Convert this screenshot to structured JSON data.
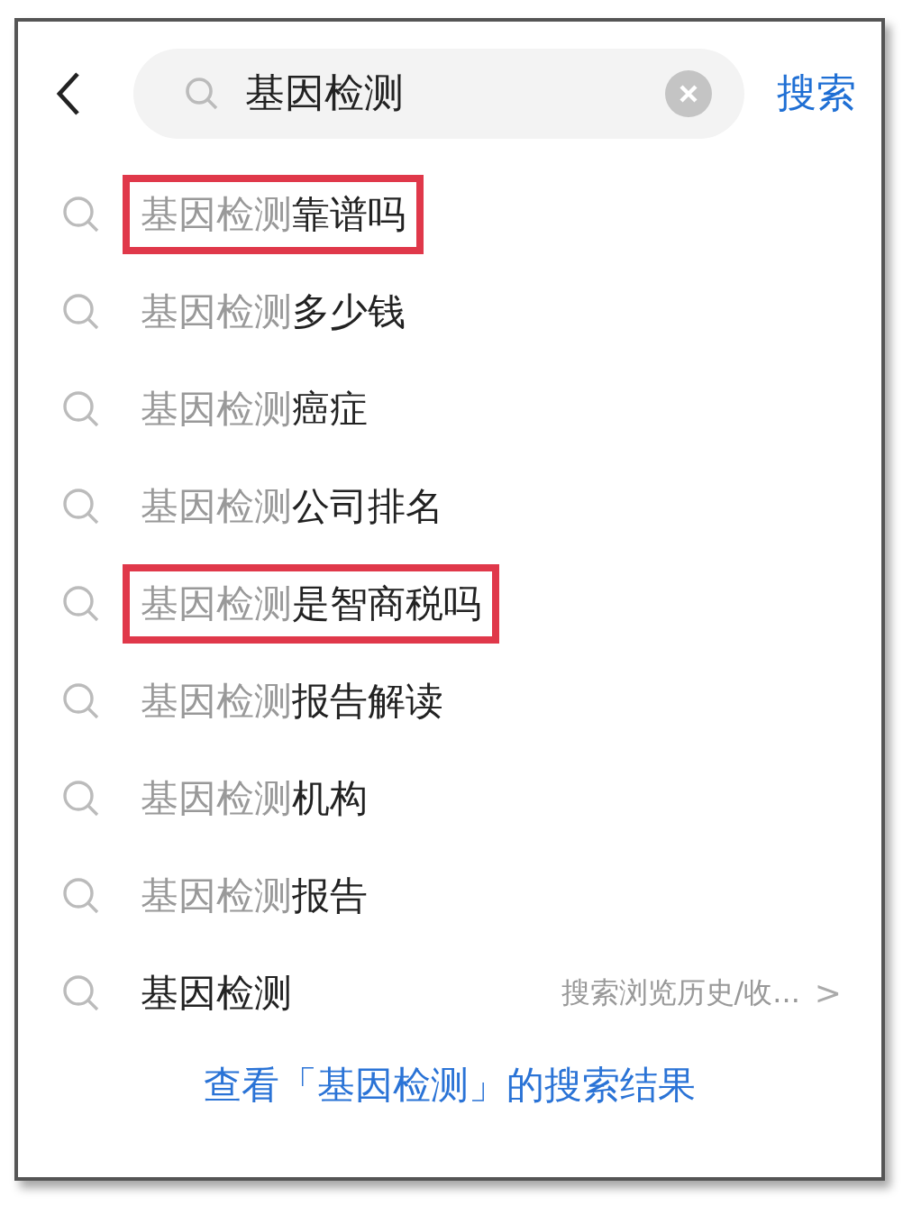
{
  "search": {
    "value": "基因检测",
    "button": "搜索"
  },
  "suggestions": [
    {
      "kind": "suggestion",
      "prefix": "基因检测",
      "suffix": "靠谱吗",
      "highlighted": true
    },
    {
      "kind": "suggestion",
      "prefix": "基因检测",
      "suffix": "多少钱",
      "highlighted": false
    },
    {
      "kind": "suggestion",
      "prefix": "基因检测",
      "suffix": "癌症",
      "highlighted": false
    },
    {
      "kind": "suggestion",
      "prefix": "基因检测",
      "suffix": "公司排名",
      "highlighted": false
    },
    {
      "kind": "suggestion",
      "prefix": "基因检测",
      "suffix": "是智商税吗",
      "highlighted": true
    },
    {
      "kind": "suggestion",
      "prefix": "基因检测",
      "suffix": "报告解读",
      "highlighted": false
    },
    {
      "kind": "suggestion",
      "prefix": "基因检测",
      "suffix": "机构",
      "highlighted": false
    },
    {
      "kind": "suggestion",
      "prefix": "基因检测",
      "suffix": "报告",
      "highlighted": false
    },
    {
      "kind": "history",
      "text": "基因检测",
      "hint": "搜索浏览历史/收...",
      "arrow": ">"
    }
  ],
  "results_link": "查看「基因检测」的搜索结果"
}
